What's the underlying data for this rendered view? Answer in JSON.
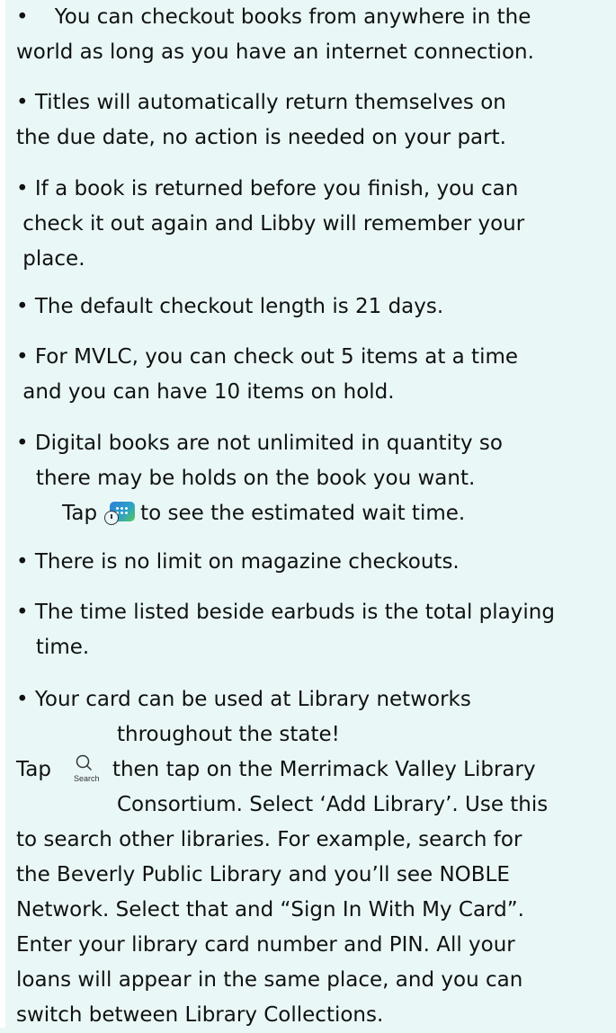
{
  "bullets": {
    "b1": {
      "line1": "•    You can checkout books from anywhere in the",
      "line2": "world as long as you have an internet connection."
    },
    "b2": {
      "line1": "• Titles will automatically return themselves on",
      "line2": "the due date, no action is needed on your part."
    },
    "b3": {
      "line1": "• If a book is returned before you finish, you can",
      "line2": " check it out again and Libby will remember your",
      "line3": " place."
    },
    "b4": {
      "line1": "• The default checkout length is 21 days."
    },
    "b5": {
      "line1": "• For MVLC, you can check out 5 items at a time",
      "line2": " and you can have 10 items on hold."
    },
    "b6": {
      "line1": "• Digital books are not unlimited in quantity so",
      "line2": "   there may be holds on the book you want.",
      "line3_pre": "       Tap",
      "line3_post": "to see the estimated wait time."
    },
    "b7": {
      "line1": "• There is no limit on magazine checkouts."
    },
    "b8": {
      "line1": "• The time listed beside earbuds is the total playing",
      "line2": "   time."
    },
    "b9": {
      "line1": "• Your card can be used at Library networks",
      "line2": "throughout the state!",
      "tap": "Tap",
      "line3": "then tap on the Merrimack Valley Library",
      "line4": "Consortium. Select ‘Add Library’. Use this",
      "line5": "to search other libraries. For example, search for",
      "line6": "the Beverly Public Library and you’ll see NOBLE",
      "line7": "Network. Select that and “Sign In With My Card”.",
      "line8": "Enter your library card number and PIN. All your",
      "line9": "loans will appear in the same place, and you can",
      "line10": "switch between Library Collections."
    }
  },
  "icons": {
    "holds_icon": "holds-calendar-clock-icon",
    "search_icon": "search-icon",
    "search_caption": "Search"
  },
  "colors": {
    "background": "#e9f8f7",
    "text": "#111111"
  }
}
